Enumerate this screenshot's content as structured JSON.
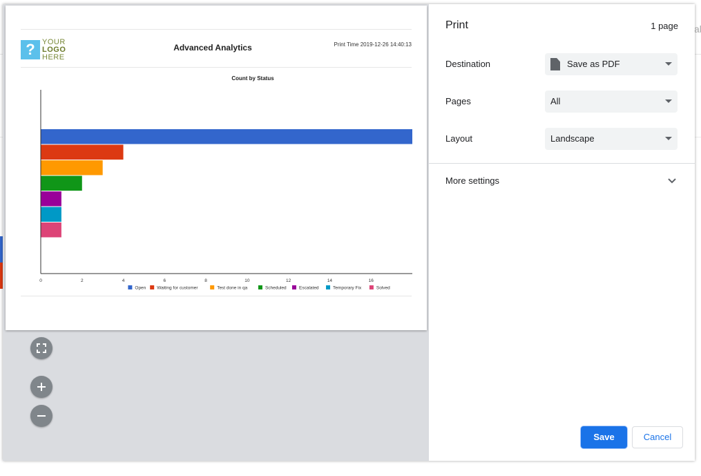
{
  "print_panel": {
    "title": "Print",
    "page_count": "1 page",
    "destination": {
      "label": "Destination",
      "value": "Save as PDF"
    },
    "pages": {
      "label": "Pages",
      "value": "All"
    },
    "layout": {
      "label": "Layout",
      "value": "Landscape"
    },
    "more_settings": "More settings",
    "save_label": "Save",
    "cancel_label": "Cancel"
  },
  "preview": {
    "logo": {
      "line1": "YOUR",
      "line2": "LOGO",
      "line3": "HERE",
      "glyph": "?"
    },
    "report_title": "Advanced Analytics",
    "print_time": "Print Time 2019-12-26 14:40:13"
  },
  "chart_data": {
    "type": "bar",
    "orientation": "horizontal",
    "title": "Count by Status",
    "categories": [
      "Open",
      "Waiting for customer",
      "Test done in qa",
      "Scheduled",
      "Escalated",
      "Temporary Fix",
      "Solved"
    ],
    "values": [
      18,
      4,
      3,
      2,
      1,
      1,
      1
    ],
    "colors": [
      "#3366cc",
      "#dc3912",
      "#ff9900",
      "#109618",
      "#990099",
      "#0099c6",
      "#dd4477"
    ],
    "x_ticks": [
      "0",
      "2",
      "4",
      "6",
      "8",
      "10",
      "12",
      "14",
      "16"
    ],
    "xlim": [
      0,
      18
    ],
    "legend_position": "bottom"
  },
  "icons": {
    "fit": "fit-to-page-icon",
    "zoom_in": "zoom-in-icon",
    "zoom_out": "zoom-out-icon"
  },
  "background": {
    "edge_text": "al"
  }
}
